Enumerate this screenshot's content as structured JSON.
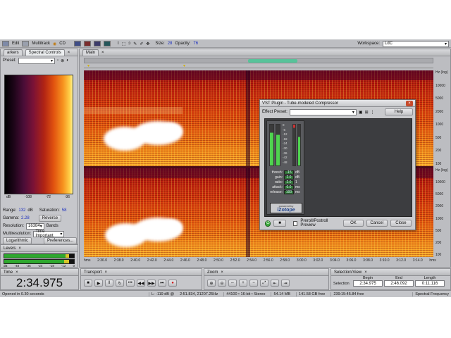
{
  "menu": {
    "edit": "Edit",
    "multitrack": "Multitrack",
    "cd": "CD",
    "size_label": "Size:",
    "size_value": "28",
    "opacity_label": "Opacity:",
    "opacity_value": "76",
    "workspace_label": "Workspace:",
    "workspace_value": "LdC"
  },
  "left_panel": {
    "tabs": [
      "arkers",
      "Spectral Controls"
    ],
    "preset_label": "Preset:",
    "gradient_ticks": [
      "dB",
      "-108",
      "-72",
      "-36"
    ],
    "range_label": "Range:",
    "range_value": "132",
    "range_unit": "dB",
    "saturation_label": "Saturation:",
    "saturation_value": "58",
    "gamma_label": "Gamma:",
    "gamma_value": "2.28",
    "reverse_label": "Reverse",
    "resolution_label": "Resolution:",
    "resolution_value": "16384",
    "bands_label": "Bands",
    "multiresolution_label": "Multiresolution:",
    "multiresolution_value": "Time Important",
    "logarithmic_label": "Logarithmic",
    "preferences_label": "Preferences..."
  },
  "levels": {
    "title": "Levels",
    "ticks": [
      "dB",
      "-48",
      "-36",
      "-24",
      "-18",
      "-12",
      "0"
    ]
  },
  "main": {
    "tab": "Main",
    "time_ticks": [
      "hms",
      "2:36.0",
      "2:38.0",
      "2:40.0",
      "2:42.0",
      "2:44.0",
      "2:46.0",
      "2:48.0",
      "2:50.0",
      "2:52.0",
      "2:54.0",
      "2:56.0",
      "2:58.0",
      "3:00.0",
      "3:02.0",
      "3:04.0",
      "3:06.0",
      "3:08.0",
      "3:10.0",
      "3:12.0",
      "3:14.0",
      "hms"
    ],
    "freq_ticks_top": [
      "Hz (log)",
      "10000",
      "5000",
      "2000",
      "1000",
      "500",
      "200",
      "100"
    ],
    "freq_ticks_bottom": [
      "Hz (log)",
      "10000",
      "5000",
      "2000",
      "1000",
      "500",
      "200",
      "100"
    ]
  },
  "plugin": {
    "title": "VST Plugin - Tube-modeled Compressor",
    "effect_preset_label": "Effect Preset:",
    "help_label": "Help",
    "params": [
      {
        "label": "thresh:",
        "value": "-15",
        "unit": "dB"
      },
      {
        "label": "gain:",
        "value": "2.0",
        "unit": "dB"
      },
      {
        "label": "ratio:",
        "value": "2.0",
        "unit": "1"
      },
      {
        "label": "attack:",
        "value": "0.0",
        "unit": "ms"
      },
      {
        "label": "release:",
        "value": "100",
        "unit": "ms"
      }
    ],
    "meter_ticks": [
      "0",
      "-6",
      "-12",
      "-18",
      "-24",
      "-30",
      "-36",
      "-42",
      "-48"
    ],
    "brand_small": "powered by",
    "brand": "iZotope",
    "preroll_label": "Preroll/Postroll Preview",
    "ok_label": "OK",
    "cancel_label": "Cancel",
    "close_label": "Close"
  },
  "time_panel": {
    "title": "Time",
    "value": "2:34.975"
  },
  "transport": {
    "title": "Transport",
    "buttons": [
      "stop-icon",
      "play-icon",
      "pause-icon",
      "play-loop-icon",
      "skip-back-icon",
      "rewind-icon",
      "forward-icon",
      "skip-forward-icon",
      "record-icon"
    ]
  },
  "zoom": {
    "title": "Zoom"
  },
  "selection": {
    "title": "Selection/View",
    "begin_label": "Begin",
    "end_label": "End",
    "length_label": "Length",
    "row_label": "Selection",
    "begin": "2:34.975",
    "end": "2:46.092",
    "length": "0:11.116"
  },
  "status": {
    "opened": "Opened in 0.30 seconds",
    "level": "L: -119 dB @",
    "position": "2:51.834, 21207.25Hz",
    "format": "44100 • 16-bit • Stereo",
    "size": "54.14 MB",
    "free": "141.58 GB free",
    "free_time": "239:15:45.84 free",
    "view": "Spectral Frequency"
  },
  "colors": {
    "accent": "#1c2fbf",
    "meter_green": "#4fd34f",
    "record_red": "#d01818"
  }
}
